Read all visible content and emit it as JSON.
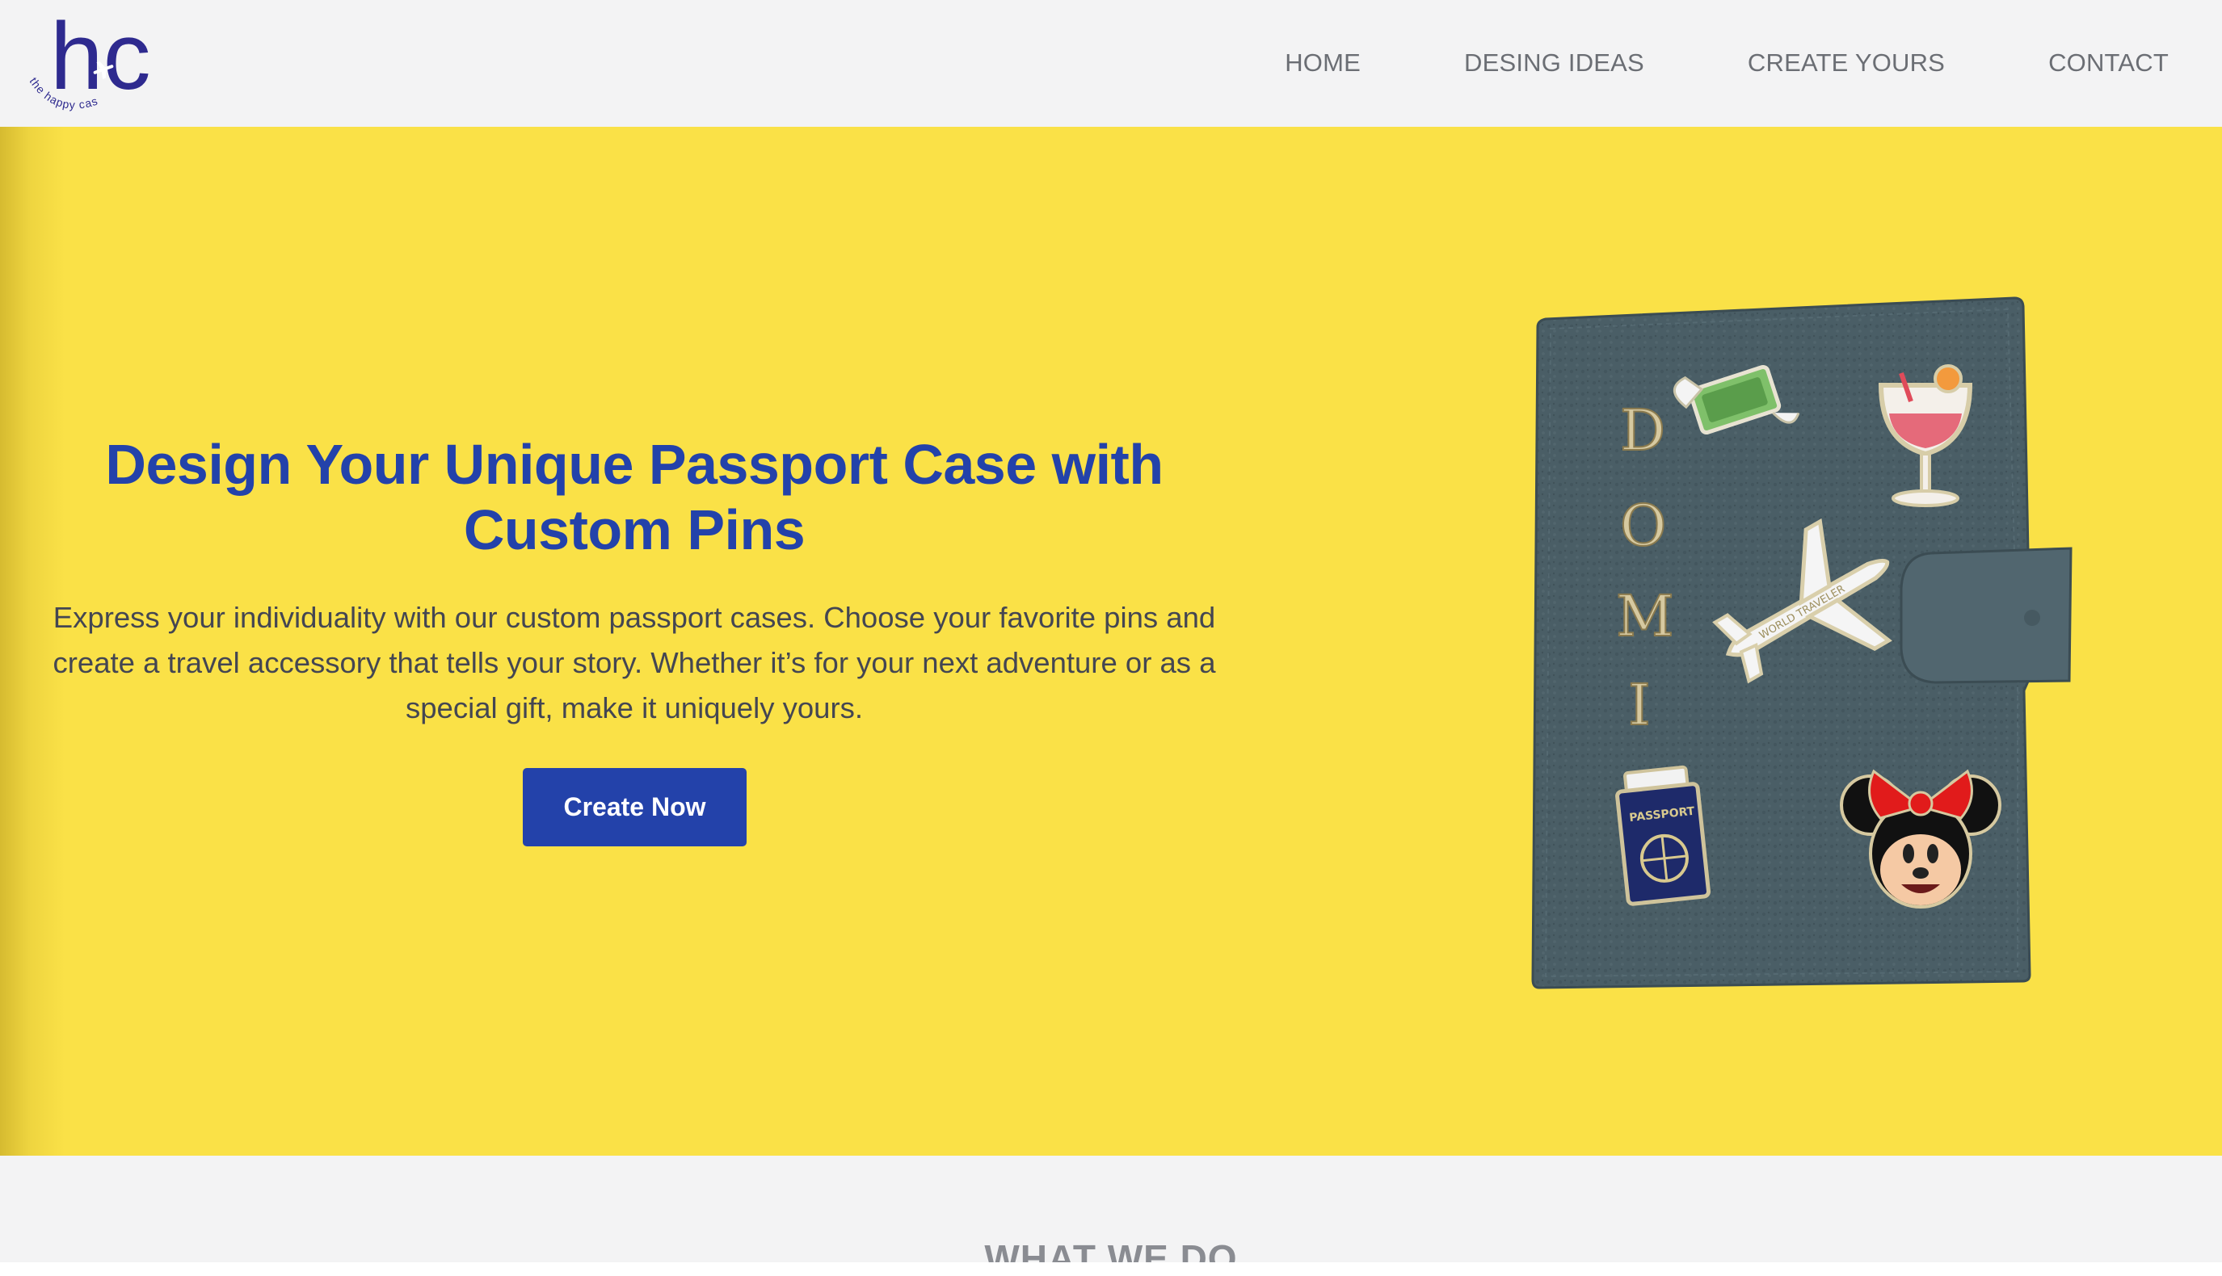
{
  "brand": {
    "logo_letters": "hc",
    "logo_tagline": "the happy case",
    "logo_color": "#2e2a8f"
  },
  "nav": {
    "items": [
      {
        "label": "HOME"
      },
      {
        "label": "DESING IDEAS"
      },
      {
        "label": "CREATE YOURS"
      },
      {
        "label": "CONTACT"
      }
    ]
  },
  "hero": {
    "title": "Design Your Unique Passport Case with Custom Pins",
    "description": "Express your individuality with our custom passport cases. Choose your favorite pins and create a travel accessory that tells your story. Whether it’s for your next adventure or as a special gift, make it uniquely yours.",
    "cta_label": "Create Now",
    "background_color": "#fae147",
    "accent_color": "#2342aa"
  },
  "product_image": {
    "letters": [
      "D",
      "O",
      "M",
      "I"
    ],
    "plane_text": "WORLD TRAVELER",
    "passport_text": "PASSPORT",
    "case_color": "#4a5e66"
  },
  "section": {
    "title": "WHAT WE DO"
  }
}
